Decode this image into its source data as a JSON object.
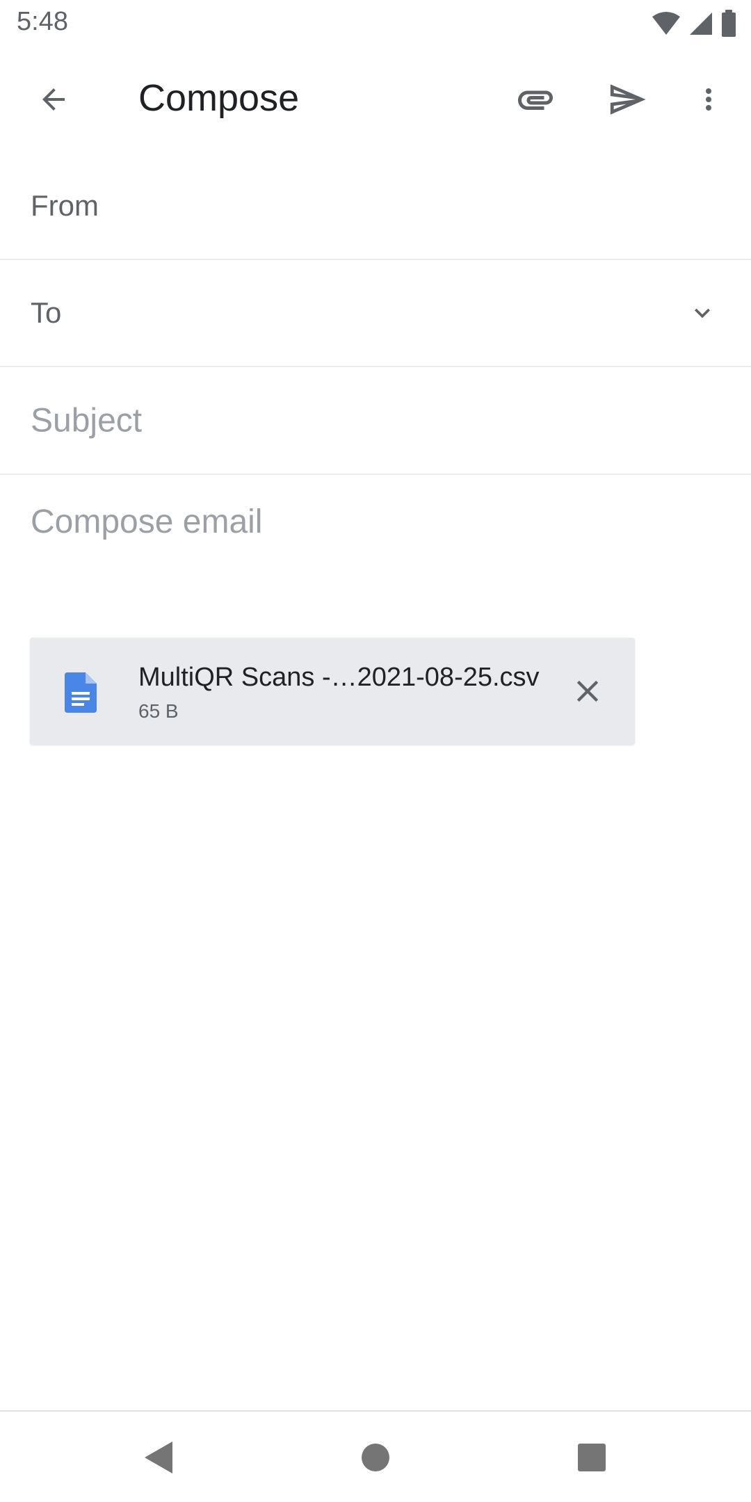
{
  "status_bar": {
    "time": "5:48",
    "icons": [
      "wifi-icon",
      "cell-signal-icon",
      "battery-icon"
    ]
  },
  "app_bar": {
    "title": "Compose",
    "icons": {
      "back": "arrow-back-icon",
      "attach": "paperclip-icon",
      "send": "send-icon",
      "more": "more-vert-icon"
    }
  },
  "fields": {
    "from_label": "From",
    "to_label": "To",
    "subject_placeholder": "Subject",
    "body_placeholder": "Compose email"
  },
  "attachment": {
    "name": "MultiQR Scans -…2021-08-25.csv",
    "size": "65 B",
    "icon": "document-icon",
    "icon_color": "#4a86e8"
  },
  "nav_bar": {
    "icons": [
      "nav-back-icon",
      "nav-home-icon",
      "nav-recents-icon"
    ]
  },
  "colors": {
    "icon_gray": "#5f6368",
    "placeholder_gray": "#9aa0a6",
    "card_bg": "#e8eaed"
  }
}
